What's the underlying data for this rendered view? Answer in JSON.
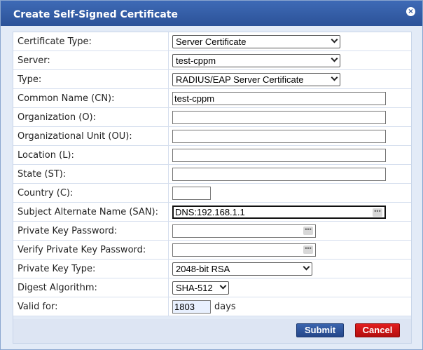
{
  "dialog": {
    "title": "Create Self-Signed Certificate",
    "close_glyph": "×"
  },
  "form": {
    "certificate_type": {
      "label": "Certificate Type:",
      "value": "Server Certificate"
    },
    "server": {
      "label": "Server:",
      "value": "test-cppm"
    },
    "type": {
      "label": "Type:",
      "value": "RADIUS/EAP Server Certificate"
    },
    "common_name": {
      "label": "Common Name (CN):",
      "value": "test-cppm"
    },
    "organization": {
      "label": "Organization (O):",
      "value": ""
    },
    "organizational_unit": {
      "label": "Organizational Unit (OU):",
      "value": ""
    },
    "location": {
      "label": "Location (L):",
      "value": ""
    },
    "state": {
      "label": "State (ST):",
      "value": ""
    },
    "country": {
      "label": "Country (C):",
      "value": ""
    },
    "san": {
      "label": "Subject Alternate Name (SAN):",
      "value": "DNS:192.168.1.1"
    },
    "private_key_password": {
      "label": "Private Key Password:",
      "value": ""
    },
    "verify_private_key_password": {
      "label": "Verify Private Key Password:",
      "value": ""
    },
    "private_key_type": {
      "label": "Private Key Type:",
      "value": "2048-bit RSA"
    },
    "digest_algorithm": {
      "label": "Digest Algorithm:",
      "value": "SHA-512"
    },
    "valid_for": {
      "label": "Valid for:",
      "value": "1803",
      "suffix": "days"
    }
  },
  "buttons": {
    "submit": "Submit",
    "cancel": "Cancel"
  },
  "icons": {
    "password_dots": "•••"
  },
  "colors": {
    "title_bar": "#2c5298",
    "submit": "#25478a",
    "cancel": "#c41414",
    "panel_bg": "#e3ebf7"
  }
}
